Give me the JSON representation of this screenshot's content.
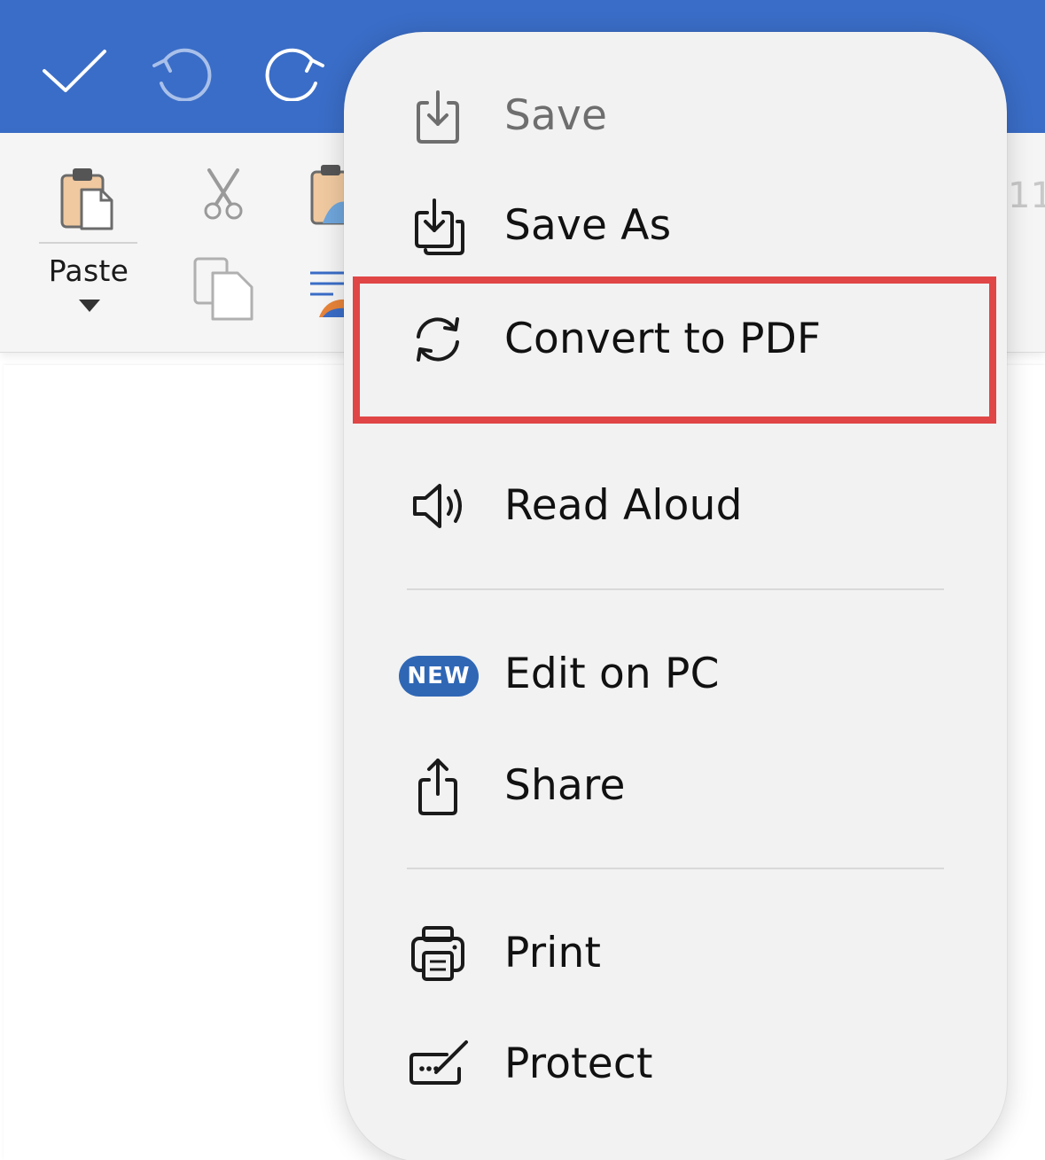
{
  "titlebar": {
    "done_icon": "checkmark-icon",
    "undo_icon": "undo-icon",
    "redo_icon": "redo-icon",
    "color": "#3a6dc7"
  },
  "ribbon": {
    "paste_label": "Paste",
    "font_size_partial": "11",
    "icons": [
      "paste-clipboard-icon",
      "cut-scissors-icon",
      "copy-icon",
      "format-painter-icon",
      "paragraph-style-icon"
    ]
  },
  "menu": {
    "items": [
      {
        "label": "Save",
        "icon": "save-download-icon",
        "state": "disabled"
      },
      {
        "label": "Save As",
        "icon": "save-as-icon"
      },
      {
        "label": "Convert to PDF",
        "icon": "convert-sync-icon",
        "highlighted": true
      },
      {
        "label": "Read Aloud",
        "icon": "speaker-icon"
      },
      {
        "label": "Edit on PC",
        "badge": "NEW"
      },
      {
        "label": "Share",
        "icon": "share-upload-icon"
      },
      {
        "label": "Print",
        "icon": "printer-icon"
      },
      {
        "label": "Protect",
        "icon": "signature-pen-icon"
      }
    ],
    "highlight_color": "#e04646",
    "badge_color": "#2f67b5"
  }
}
